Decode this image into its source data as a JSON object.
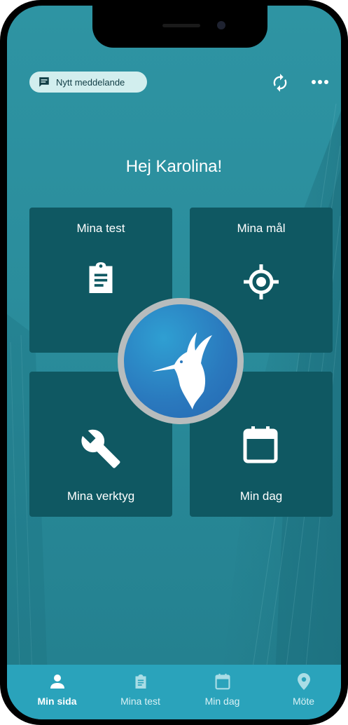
{
  "header": {
    "message_button_label": "Nytt meddelande",
    "message_icon": "chat-icon",
    "sync_icon": "sync-icon",
    "more_icon": "more-horizontal-icon"
  },
  "greeting": "Hej Karolina!",
  "tiles": [
    {
      "label": "Mina test",
      "icon": "clipboard-icon"
    },
    {
      "label": "Mina mål",
      "icon": "target-icon"
    },
    {
      "label": "Mina verktyg",
      "icon": "wrench-icon"
    },
    {
      "label": "Min dag",
      "icon": "calendar-icon"
    }
  ],
  "logo": {
    "icon": "hummingbird-icon"
  },
  "tabbar": {
    "items": [
      {
        "label": "Min sida",
        "icon": "person-icon",
        "active": true
      },
      {
        "label": "Mina test",
        "icon": "clipboard-icon",
        "active": false
      },
      {
        "label": "Min dag",
        "icon": "calendar-icon",
        "active": false
      },
      {
        "label": "Möte",
        "icon": "location-pin-icon",
        "active": false
      }
    ]
  },
  "colors": {
    "background": "#2a8c9b",
    "tile": "#0f5862",
    "tabbar": "#2aa3bb",
    "message_button": "#d2eeee",
    "logo_blue": "#2a78bd",
    "active_tab_text": "#ffffff",
    "inactive_tab_text": "#d9f1f5"
  }
}
